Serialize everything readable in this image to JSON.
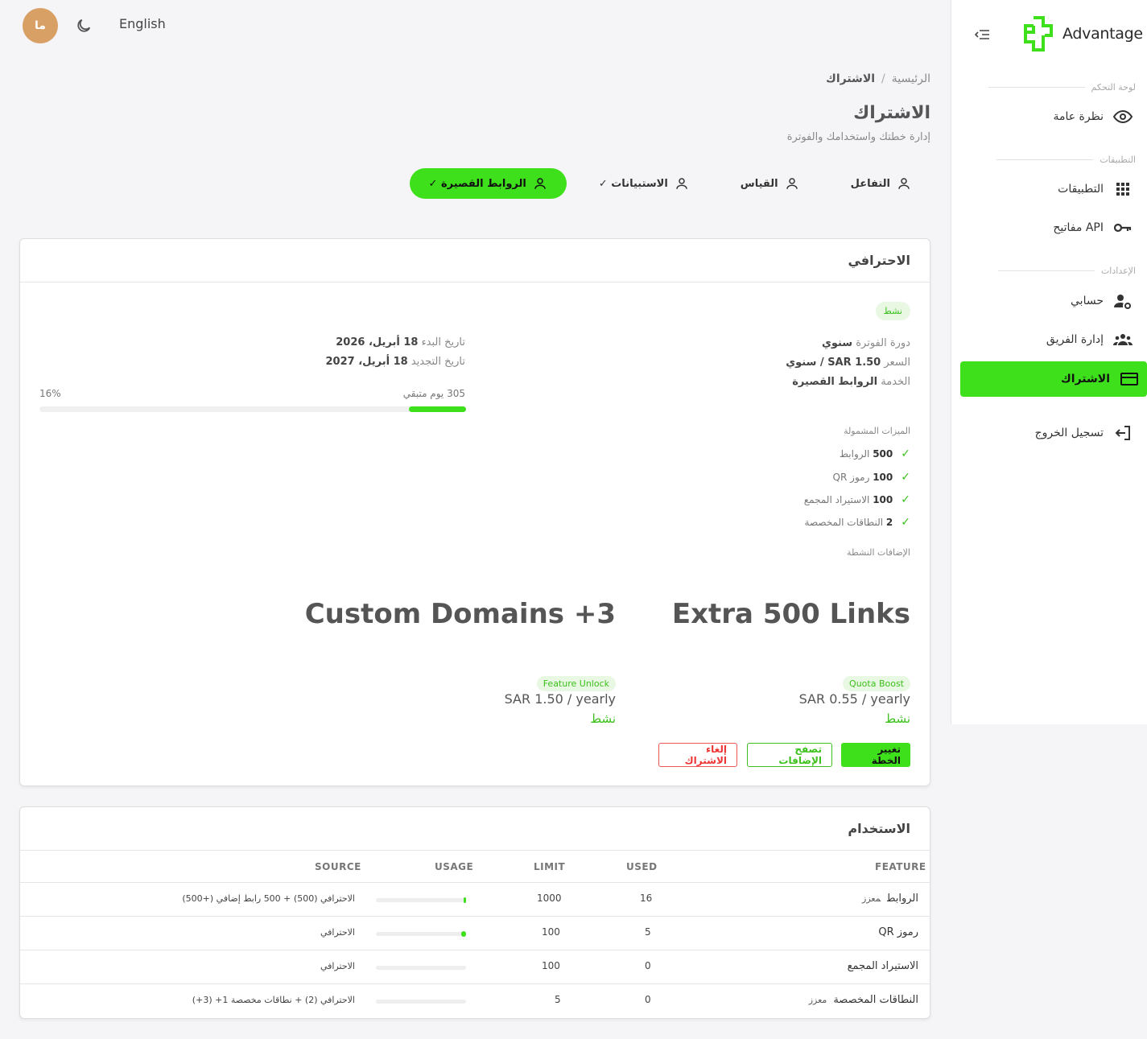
{
  "topbar": {
    "avatar_initials": "ما",
    "language": "English"
  },
  "sidebar": {
    "brand": "Advantage",
    "sections": {
      "dashboard": "لوحة التحكم",
      "apps": "التطبيقات",
      "settings": "الإعدادات"
    },
    "items": [
      {
        "label": "نظرة عامة",
        "icon": "eye-icon"
      },
      {
        "label": "التطبيقات",
        "icon": "grid-icon"
      },
      {
        "label": "مفاتيح API",
        "icon": "key-icon"
      },
      {
        "label": "حسابي",
        "icon": "user-gear-icon"
      },
      {
        "label": "إدارة الفريق",
        "icon": "users-icon"
      },
      {
        "label": "الاشتراك",
        "icon": "credit-card-icon",
        "active": true
      },
      {
        "label": "تسجيل الخروج",
        "icon": "logout-icon"
      }
    ]
  },
  "breadcrumb": {
    "home": "الرئيسية",
    "current": "الاشتراك",
    "separator": "/"
  },
  "page": {
    "title": "الاشتراك",
    "subtitle": "إدارة خطتك واستخدامك والفوترة"
  },
  "tabs": [
    {
      "label": "الروابط القصيرة ✓",
      "active": true
    },
    {
      "label": "الاستبيانات ✓"
    },
    {
      "label": "القياس"
    },
    {
      "label": "التفاعل"
    }
  ],
  "plan": {
    "name": "الاحترافي",
    "status": "نشط",
    "billing_label": "دورة الفوترة",
    "billing_value": "سنوي",
    "price_label": "السعر",
    "price_value": "SAR 1.50 / سنوي",
    "service_label": "الخدمة",
    "service_value": "الروابط القصيرة",
    "start_label": "تاريخ البدء",
    "start_value": "18 أبريل، 2026",
    "renew_label": "تاريخ التجديد",
    "renew_value": "18 أبريل، 2027",
    "days_left": "305 يوم متبقي",
    "progress_pct_label": "16%",
    "progress_remaining_fraction": 0.84,
    "features_label": "الميزات المشمولة",
    "features": [
      {
        "count": "500",
        "name": "الروابط"
      },
      {
        "count": "100",
        "name": "رموز QR"
      },
      {
        "count": "100",
        "name": "الاستيراد المجمع"
      },
      {
        "count": "2",
        "name": "النطاقات المخصصة"
      }
    ],
    "addons_label": "الإضافات النشطة",
    "addons": [
      {
        "title": "Extra 500 Links",
        "tag": "Quota Boost",
        "price": "SAR 0.55 / yearly",
        "status": "نشط"
      },
      {
        "title": "Custom Domains +3",
        "tag": "Feature Unlock",
        "price": "SAR 1.50 / yearly",
        "status": "نشط"
      }
    ],
    "buttons": {
      "change": "تغيير الخطة",
      "browse": "تصفح الإضافات",
      "cancel": "إلغاء الاشتراك"
    }
  },
  "usage": {
    "title": "الاستخدام",
    "columns": {
      "feature": "FEATURE",
      "used": "USED",
      "limit": "LIMIT",
      "usage": "USAGE",
      "source": "SOURCE"
    },
    "rows": [
      {
        "feature": "الروابط",
        "tag": "معزز",
        "used": "16",
        "limit": "1000",
        "fraction": 0.016,
        "source": "الاحترافي (500) + 500 رابط إضافي (+500)"
      },
      {
        "feature": "رموز QR",
        "tag": "",
        "used": "5",
        "limit": "100",
        "fraction": 0.05,
        "source": "الاحترافي"
      },
      {
        "feature": "الاستيراد المجمع",
        "tag": "",
        "used": "0",
        "limit": "100",
        "fraction": 0,
        "source": "الاحترافي"
      },
      {
        "feature": "النطاقات المخصصة",
        "tag": "معزز",
        "used": "0",
        "limit": "5",
        "fraction": 0,
        "source": "الاحترافي (2) + نطاقات مخصصة 1+ (3+)"
      }
    ]
  },
  "colors": {
    "accent": "#3ee01c",
    "avatar": "#d9a066",
    "danger": "#e33333"
  }
}
